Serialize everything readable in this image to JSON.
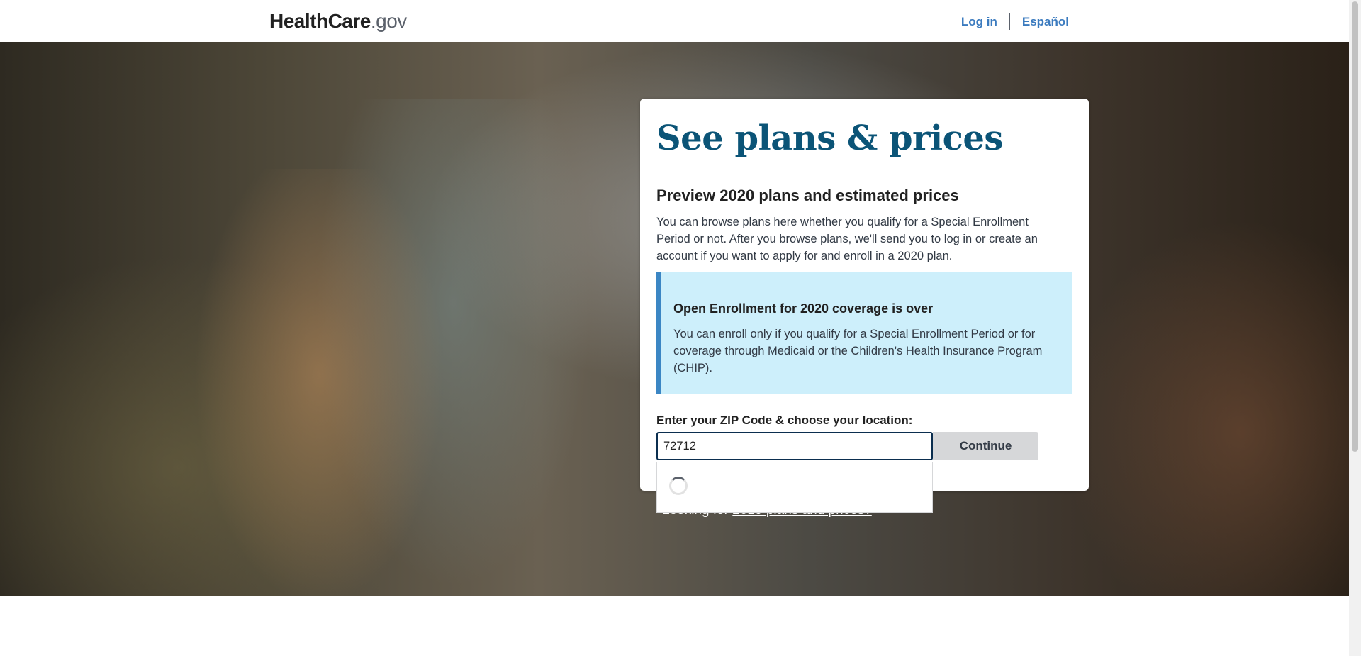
{
  "header": {
    "logo_main": "HealthCare",
    "logo_suffix": ".gov",
    "nav": {
      "login": "Log in",
      "language": "Español"
    }
  },
  "card": {
    "title": "See plans & prices",
    "subtitle": "Preview 2020 plans and estimated prices",
    "intro": "You can browse plans here whether you qualify for a Special Enrollment Period or not. After you browse plans, we'll send you to log in or create an account if you want to apply for and enroll in a 2020 plan.",
    "alert": {
      "title": "Open Enrollment for 2020 coverage is over",
      "body": "You can enroll only if you qualify for a Special Enrollment Period or for coverage through Medicaid or the Children's Health Insurance Program (CHIP)."
    },
    "zip": {
      "label": "Enter your ZIP Code & choose your location:",
      "value": "72712"
    },
    "continue_label": "Continue"
  },
  "looking": {
    "prefix": "Looking for ",
    "link": "2019 plans and prices?"
  },
  "colors": {
    "title": "#0b5477",
    "link": "#3b7bbf",
    "alert_bg": "#cdeffb",
    "alert_border": "#3b86c4"
  }
}
